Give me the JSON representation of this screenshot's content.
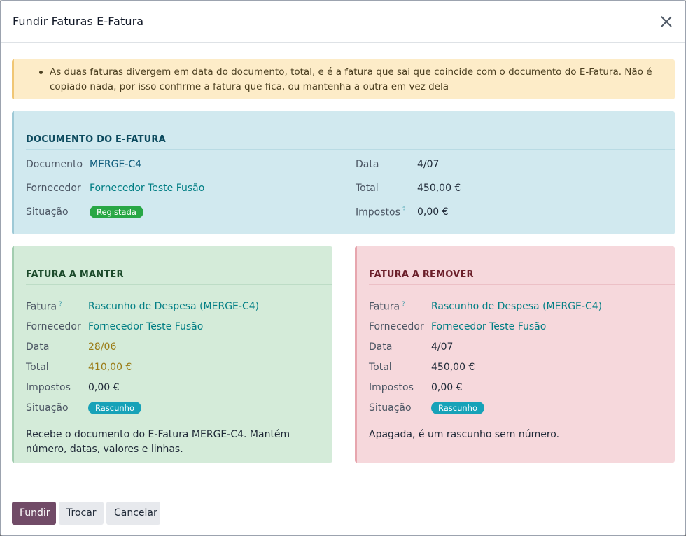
{
  "dialog": {
    "title": "Fundir Faturas E-Fatura",
    "close_icon": "close-icon"
  },
  "alert": {
    "text": "As duas faturas divergem em data do documento, total, e é a fatura que sai que coincide com o documento do E-Fatura. Não é copiado nada, por isso confirme a fatura que fica, ou mantenha a outra em vez dela"
  },
  "efatura": {
    "heading": "DOCUMENTO DO E-FATURA",
    "documento_label": "Documento",
    "documento_value": "MERGE-C4",
    "fornecedor_label": "Fornecedor",
    "fornecedor_value": "Fornecedor Teste Fusão",
    "situacao_label": "Situação",
    "situacao_value": "Registada",
    "data_label": "Data",
    "data_value": "4/07",
    "total_label": "Total",
    "total_value": "450,00 €",
    "impostos_label": "Impostos",
    "impostos_help": "?",
    "impostos_value": "0,00 €"
  },
  "keep": {
    "heading": "FATURA A MANTER",
    "fatura_label": "Fatura",
    "fatura_help": "?",
    "fatura_value": "Rascunho de Despesa (MERGE-C4)",
    "fornecedor_label": "Fornecedor",
    "fornecedor_value": "Fornecedor Teste Fusão",
    "data_label": "Data",
    "data_value": "28/06",
    "total_label": "Total",
    "total_value": "410,00 €",
    "impostos_label": "Impostos",
    "impostos_value": "0,00 €",
    "situacao_label": "Situação",
    "situacao_value": "Rascunho",
    "note": "Recebe o documento do E-Fatura MERGE-C4. Mantém número, datas, valores e linhas."
  },
  "remove": {
    "heading": "FATURA A REMOVER",
    "fatura_label": "Fatura",
    "fatura_help": "?",
    "fatura_value": "Rascunho de Despesa (MERGE-C4)",
    "fornecedor_label": "Fornecedor",
    "fornecedor_value": "Fornecedor Teste Fusão",
    "data_label": "Data",
    "data_value": "4/07",
    "total_label": "Total",
    "total_value": "450,00 €",
    "impostos_label": "Impostos",
    "impostos_value": "0,00 €",
    "situacao_label": "Situação",
    "situacao_value": "Rascunho",
    "note": "Apagada, é um rascunho sem número."
  },
  "footer": {
    "fundir_label": "Fundir",
    "trocar_label": "Trocar",
    "cancelar_label": "Cancelar"
  },
  "colors": {
    "primary": "#714b67",
    "efatura_bg": "#d1e9ef",
    "keep_bg": "#d4ebd9",
    "remove_bg": "#f6d8dc",
    "warning_bg": "#fdecc8",
    "badge_green": "#28a745",
    "badge_teal": "#17a2b8"
  }
}
